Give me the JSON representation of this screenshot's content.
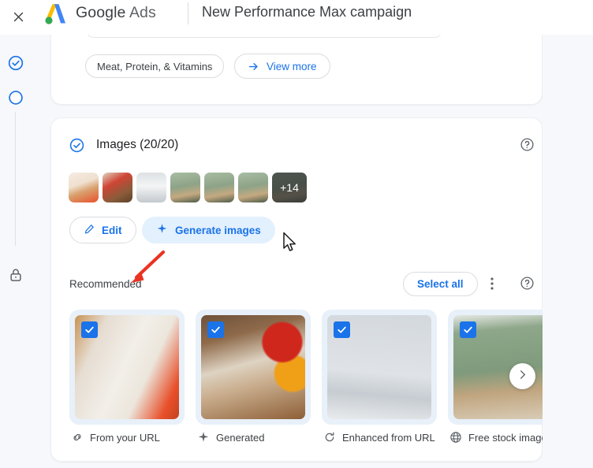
{
  "topbar": {
    "close_icon": "close-icon",
    "logo_icon": "google-ads-logo-icon",
    "brand_google": "Google",
    "brand_ads": "Ads",
    "campaign_title": "New Performance Max campaign"
  },
  "rail": {
    "step_done_icon": "check-circle-icon",
    "step_current_icon": "circle-outline-icon",
    "lock_icon": "lock-icon"
  },
  "top_card": {
    "chip_label": "Meat, Protein, & Vitamins",
    "view_more_label": "View more",
    "view_more_icon": "arrow-right-icon"
  },
  "images_section": {
    "status_icon": "check-circle-icon",
    "title": "Images (20/20)",
    "help_icon": "help-circle-icon",
    "thumbnails": [
      {
        "name": "thumbnail-1",
        "colors": [
          "#f0e2d4",
          "#d8b38a",
          "#e85d3a"
        ]
      },
      {
        "name": "thumbnail-2",
        "colors": [
          "#6b4a32",
          "#d9cbb5",
          "#c9382a"
        ]
      },
      {
        "name": "thumbnail-3",
        "colors": [
          "#cfd4d6",
          "#f3f4f5",
          "#b9bfc2"
        ]
      },
      {
        "name": "thumbnail-4",
        "colors": [
          "#9db39a",
          "#c9b391",
          "#50604c"
        ]
      },
      {
        "name": "thumbnail-5",
        "colors": [
          "#9db39a",
          "#c9b391",
          "#50604c"
        ]
      },
      {
        "name": "thumbnail-6",
        "colors": [
          "#9db39a",
          "#c9b391",
          "#50604c"
        ]
      }
    ],
    "more_count_label": "+14",
    "edit_label": "Edit",
    "edit_icon": "pencil-icon",
    "generate_label": "Generate images",
    "generate_icon": "sparkle-icon"
  },
  "recommended": {
    "label": "Recommended",
    "select_all_label": "Select all",
    "kebab_icon": "more-vert-icon",
    "help_icon": "help-circle-icon",
    "next_icon": "chevron-right-icon",
    "cards": [
      {
        "caption": "From your URL",
        "caption_icon": "link-icon",
        "checked": true,
        "colors": [
          "#e9e4dd",
          "#c48a4e",
          "#e8502a"
        ]
      },
      {
        "caption": "Generated",
        "caption_icon": "sparkle-icon",
        "checked": true,
        "colors": [
          "#8b5f3c",
          "#ded3c2",
          "#cf2b24"
        ]
      },
      {
        "caption": "Enhanced from URL",
        "caption_icon": "enhance-icon",
        "checked": true,
        "colors": [
          "#d4d8dc",
          "#f4f5f6",
          "#b0b7bd"
        ]
      },
      {
        "caption": "Free stock image",
        "caption_icon": "globe-icon",
        "checked": true,
        "colors": [
          "#8fa98b",
          "#c7ab85",
          "#4e5c4b"
        ]
      }
    ]
  },
  "annotation": {
    "arrow_icon": "red-annotation-arrow-icon",
    "color": "#ea3323"
  },
  "cursor": {
    "icon": "mouse-pointer-icon"
  },
  "colors": {
    "accent_blue": "#1a73e8",
    "page_bg": "#f6f8fb",
    "card_bg": "#ffffff",
    "text_primary": "#202124",
    "text_secondary": "#5f6368",
    "selected_frame": "#e8f0f9"
  }
}
